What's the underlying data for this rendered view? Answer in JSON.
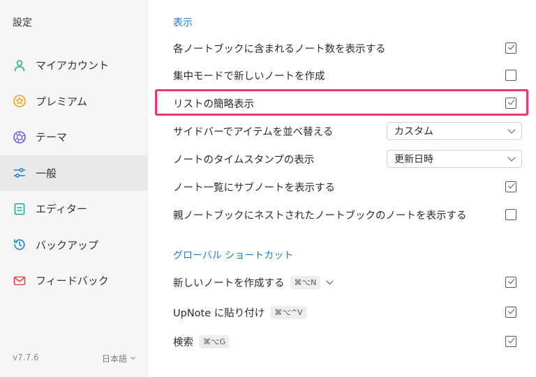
{
  "sidebar": {
    "title": "設定",
    "items": [
      {
        "label": "マイアカウント",
        "icon": "user-icon",
        "color": "#2fb36a"
      },
      {
        "label": "プレミアム",
        "icon": "premium-star-icon",
        "color": "#f2a21d"
      },
      {
        "label": "テーマ",
        "icon": "theme-aperture-icon",
        "color": "#6c63d9"
      },
      {
        "label": "一般",
        "icon": "sliders-icon",
        "color": "#1f7fd0",
        "active": true
      },
      {
        "label": "エディター",
        "icon": "document-icon",
        "color": "#1fa89a"
      },
      {
        "label": "バックアップ",
        "icon": "history-icon",
        "color": "#1f7fd0"
      },
      {
        "label": "フィードバック",
        "icon": "mail-icon",
        "color": "#e0464c"
      }
    ],
    "version": "v7.7.6",
    "language": "日本語"
  },
  "display": {
    "title": "表示",
    "rows": [
      {
        "label": "各ノートブックに含まれるノート数を表示する",
        "checked": true
      },
      {
        "label": "集中モードで新しいノートを作成",
        "checked": false
      },
      {
        "label": "リストの簡略表示",
        "checked": true,
        "highlighted": true
      },
      {
        "label": "サイドバーでアイテムを並べ替える",
        "select": "カスタム"
      },
      {
        "label": "ノートのタイムスタンプの表示",
        "select": "更新日時"
      },
      {
        "label": "ノート一覧にサブノートを表示する",
        "checked": true
      },
      {
        "label": "親ノートブックにネストされたノートブックのノートを表示する",
        "checked": false
      }
    ]
  },
  "shortcuts": {
    "title": "グローバル ショートカット",
    "rows": [
      {
        "label": "新しいノートを作成する",
        "key": "⌘⌥N",
        "checked": true
      },
      {
        "label": "UpNote に貼り付け",
        "key": "⌘⌥^V",
        "checked": true
      },
      {
        "label": "検索",
        "key": "⌘⌥G",
        "checked": true
      }
    ]
  },
  "colors": {
    "accent": "#1f7fd0",
    "highlight": "#f0336e"
  }
}
